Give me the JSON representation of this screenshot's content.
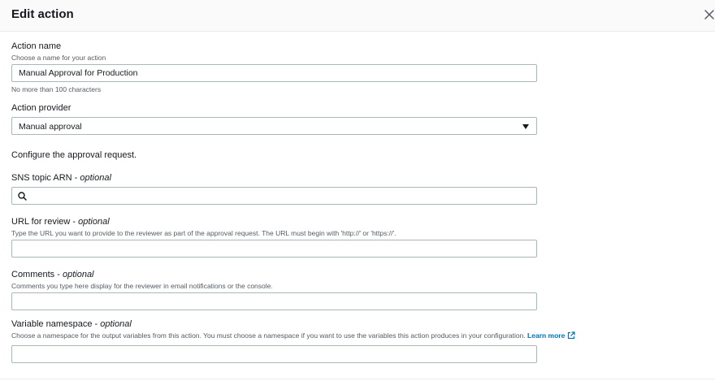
{
  "header": {
    "title": "Edit action"
  },
  "action_name": {
    "label": "Action name",
    "description": "Choose a name for your action",
    "value": "Manual Approval for Production",
    "constraint": "No more than 100 characters"
  },
  "action_provider": {
    "label": "Action provider",
    "selected": "Manual approval"
  },
  "configure_text": "Configure the approval request.",
  "sns_topic": {
    "label": "SNS topic ARN - ",
    "optional": "optional",
    "value": ""
  },
  "url_review": {
    "label": "URL for review - ",
    "optional": "optional",
    "description": "Type the URL you want to provide to the reviewer as part of the approval request. The URL must begin with 'http://' or 'https://'.",
    "value": ""
  },
  "comments": {
    "label": "Comments - ",
    "optional": "optional",
    "description": "Comments you type here display for the reviewer in email notifications or the console.",
    "value": ""
  },
  "variable_namespace": {
    "label": "Variable namespace - ",
    "optional": "optional",
    "description": "Choose a namespace for the output variables from this action. You must choose a namespace if you want to use the variables this action produces in your configuration. ",
    "learn_more": "Learn more",
    "value": ""
  },
  "icons": {
    "close": "close-icon",
    "search": "search-icon",
    "dropdown": "caret-down-icon",
    "external": "external-link-icon"
  },
  "colors": {
    "link": "#0073bb",
    "border": "#aab7b8",
    "text": "#16191f",
    "secondary": "#545b64"
  }
}
